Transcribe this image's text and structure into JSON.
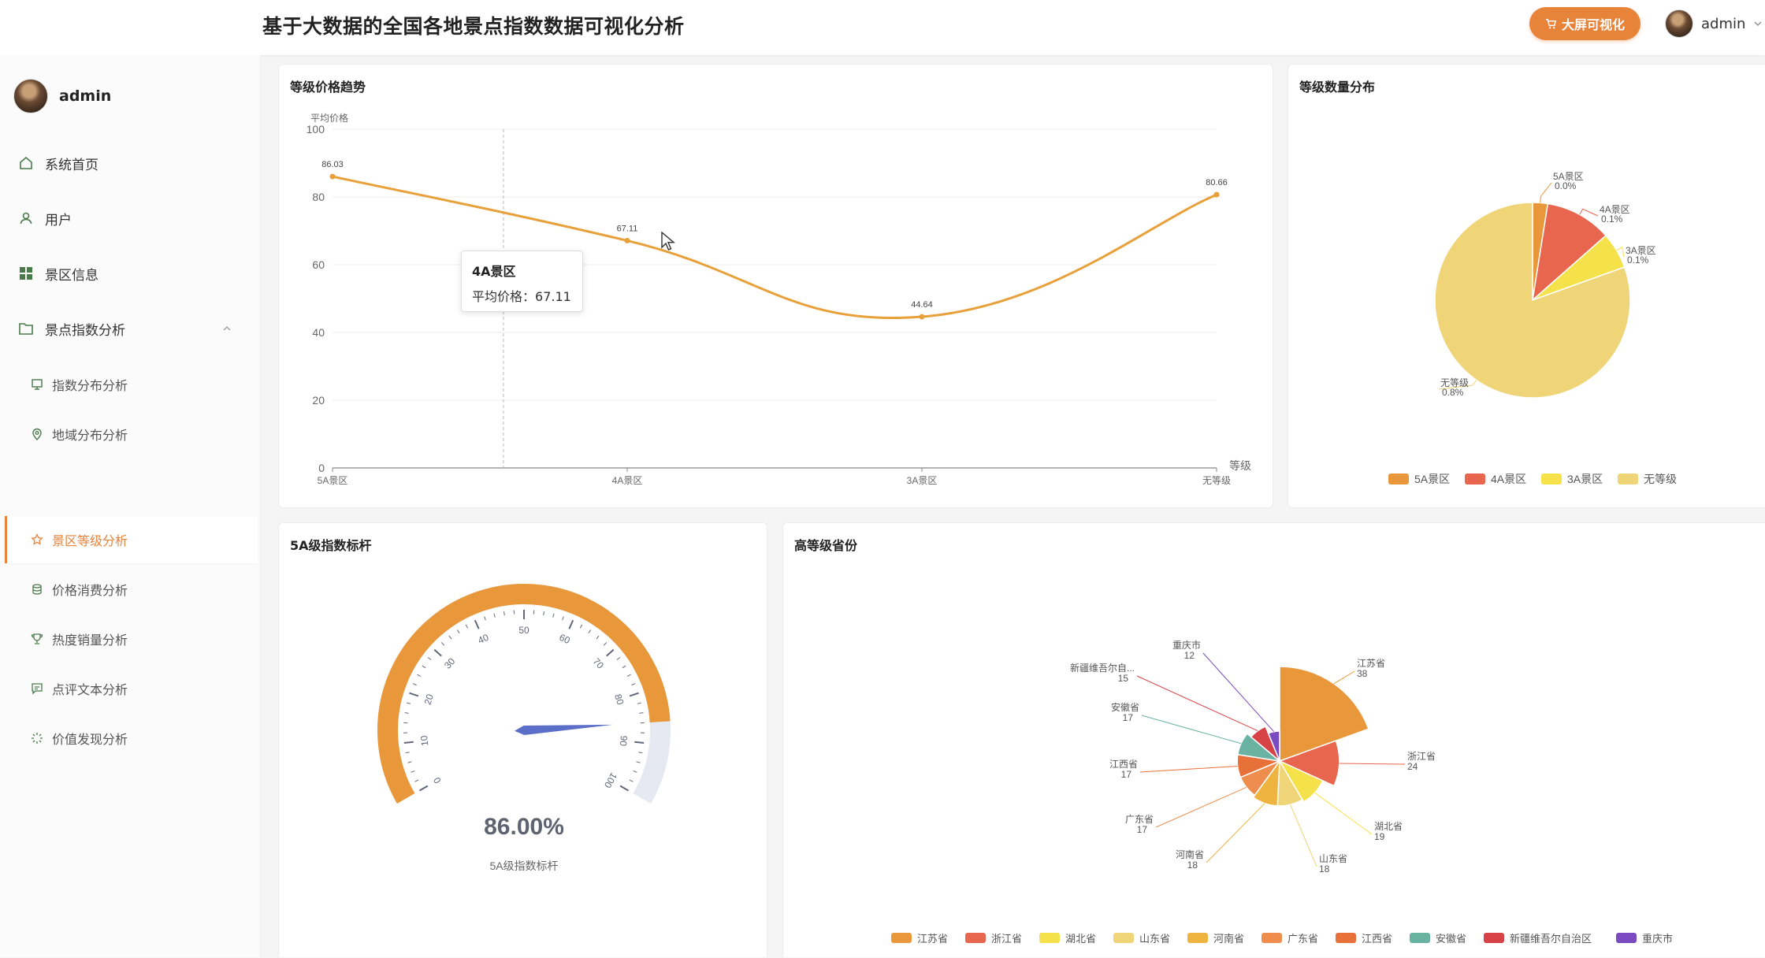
{
  "header": {
    "title": "基于大数据的全国各地景点指数数据可视化分析",
    "bigscreen_label": "大屏可视化",
    "username": "admin"
  },
  "sidebar": {
    "username": "admin",
    "items": [
      {
        "label": "系统首页",
        "icon": "home-icon"
      },
      {
        "label": "用户",
        "icon": "user-icon"
      },
      {
        "label": "景区信息",
        "icon": "grid-icon"
      },
      {
        "label": "景点指数分析",
        "icon": "folder-icon"
      }
    ],
    "subitems": [
      {
        "label": "指数分布分析",
        "icon": "monitor-icon"
      },
      {
        "label": "地域分布分析",
        "icon": "location-icon"
      },
      {
        "label": "景区等级分析",
        "icon": "star-icon"
      },
      {
        "label": "价格消费分析",
        "icon": "coins-icon"
      },
      {
        "label": "热度销量分析",
        "icon": "trophy-icon"
      },
      {
        "label": "点评文本分析",
        "icon": "comment-icon"
      },
      {
        "label": "价值发现分析",
        "icon": "sparkle-icon"
      }
    ],
    "active_subitem": "景区等级分析"
  },
  "colors": {
    "accent": "#e8833a",
    "line": "#e8a03a",
    "5A": "#e8983a",
    "4A": "#e8654e",
    "3A": "#f5e24a",
    "none": "#f0d478"
  },
  "tooltip": {
    "title": "4A景区",
    "label": "平均价格：",
    "value": "67.11"
  },
  "chart_data": [
    {
      "type": "line",
      "title": "等级价格趋势",
      "ylabel": "平均价格",
      "xlabel": "等级",
      "categories": [
        "5A景区",
        "4A景区",
        "3A景区",
        "无等级"
      ],
      "values": [
        86.03,
        67.11,
        44.64,
        80.66
      ],
      "value_labels": [
        "86.03",
        "67.11",
        "44.64",
        "80.66"
      ],
      "ylim": [
        0,
        100
      ],
      "yticks": [
        "0",
        "20",
        "40",
        "60",
        "80",
        "100"
      ],
      "smooth": true,
      "grid": true
    },
    {
      "type": "pie",
      "title": "等级数量分布",
      "labels": [
        "5A景区",
        "4A景区",
        "3A景区",
        "无等级"
      ],
      "percent_labels": [
        "0.0%",
        "0.1%",
        "0.1%",
        "0.8%"
      ],
      "values": [
        2.5,
        11,
        6,
        80.5
      ],
      "legend": "bottom"
    },
    {
      "type": "gauge",
      "title": "5A级指数标杆",
      "value": 86.0,
      "value_label": "86.00%",
      "name": "5A级指数标杆",
      "min": 0,
      "max": 100,
      "tick_labels": [
        "0",
        "10",
        "20",
        "30",
        "40",
        "50",
        "60",
        "70",
        "80",
        "90",
        "100"
      ]
    },
    {
      "type": "pie",
      "title": "高等级省份",
      "rose": true,
      "labels": [
        "江苏省",
        "浙江省",
        "湖北省",
        "山东省",
        "河南省",
        "广东省",
        "江西省",
        "安徽省",
        "新疆维吾尔自治区",
        "重庆市"
      ],
      "outer_labels": [
        "江苏省",
        "浙江省",
        "湖北省",
        "山东省",
        "河南省",
        "广东省",
        "江西省",
        "安徽省",
        "新疆维吾尔自...",
        "重庆市"
      ],
      "values": [
        38,
        24,
        19,
        18,
        18,
        17,
        17,
        17,
        15,
        12
      ],
      "colors": [
        "#e8983a",
        "#e8654e",
        "#f5e24a",
        "#f0d478",
        "#eeb43f",
        "#ee8d4e",
        "#e8713a",
        "#6ab2a2",
        "#d74247",
        "#7a4bc0"
      ],
      "legend": "bottom"
    }
  ]
}
